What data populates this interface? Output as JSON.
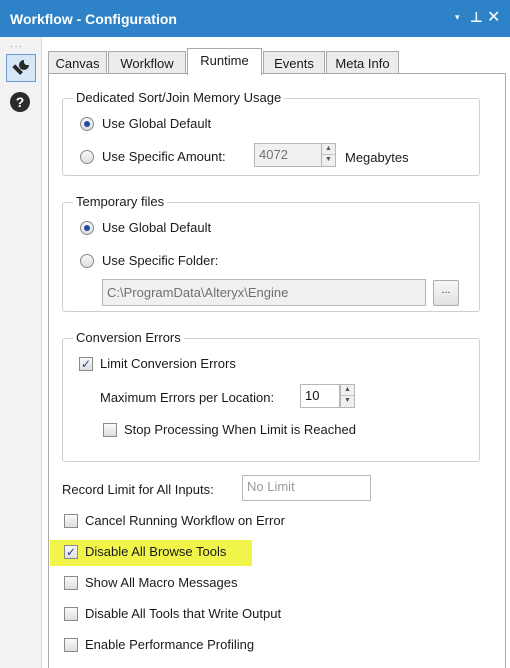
{
  "window": {
    "title": "Workflow - Configuration",
    "dropdown_icon": "▾",
    "pin_icon": "⊥",
    "close_icon": "✕"
  },
  "sidebar": {
    "dots": "···",
    "help_glyph": "?"
  },
  "tabs": [
    {
      "label": "Canvas"
    },
    {
      "label": "Workflow"
    },
    {
      "label": "Runtime",
      "active": true
    },
    {
      "label": "Events"
    },
    {
      "label": "Meta Info"
    }
  ],
  "memory": {
    "legend": "Dedicated Sort/Join Memory Usage",
    "global_label": "Use Global Default",
    "specific_label": "Use Specific Amount:",
    "amount_value": "4072",
    "unit": "Megabytes"
  },
  "temp": {
    "legend": "Temporary files",
    "global_label": "Use Global Default",
    "specific_label": "Use Specific Folder:",
    "folder_value": "C:\\ProgramData\\Alteryx\\Engine",
    "browse_label": "..."
  },
  "conversion": {
    "legend": "Conversion Errors",
    "limit_label": "Limit Conversion Errors",
    "max_label": "Maximum Errors per Location:",
    "max_value": "10",
    "stop_label": "Stop Processing When Limit is Reached"
  },
  "record_limit": {
    "label": "Record Limit for All Inputs:",
    "placeholder": "No Limit"
  },
  "options": {
    "cancel_on_error": "Cancel Running Workflow on Error",
    "disable_browse": "Disable All Browse Tools",
    "show_macro_messages": "Show All Macro Messages",
    "disable_write_output": "Disable All Tools that Write Output",
    "enable_profiling": "Enable Performance Profiling"
  },
  "check_mark": "✓",
  "colors": {
    "titlebar": "#2e83c8",
    "highlight": "#f2f549"
  }
}
